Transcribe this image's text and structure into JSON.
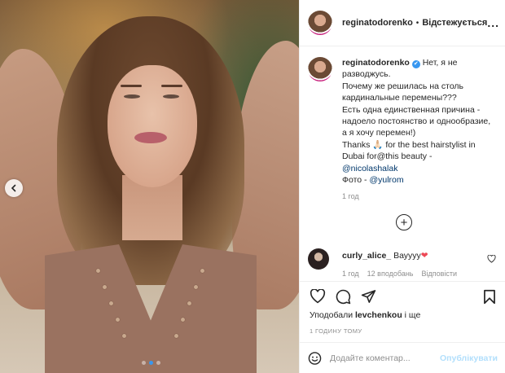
{
  "post": {
    "username": "reginatodorenko",
    "separator": "•",
    "follow_label": "Відстежується",
    "more_label": "..."
  },
  "caption": {
    "username": "reginatodorenko",
    "verified_mark": "✔",
    "lines": [
      "Нет, я не разводжусь.",
      "Почему же решилась на столь кардинальные перемены???",
      "Есть одна единственная причина - надоело постоянство и однообразие, а я хочу перемен!)",
      "Thanks 🙏🏻 for the best hairstylist in Dubai for@this beauty -",
      "@nicolashalak",
      "Фото - ",
      "@yulrom"
    ],
    "time_ago": "1 год"
  },
  "load_more_label": "+",
  "comment": {
    "username": "curly_alice_",
    "text": "Вауууу",
    "heart": "❤",
    "time": "1 год",
    "likes": "12 вподобань",
    "reply_label": "Відповісти"
  },
  "likes": {
    "prefix": "Уподобали ",
    "user": "levchenkou",
    "suffix": " і ще"
  },
  "posted_time": "1 ГОДИНУ ТОМУ",
  "comment_input": {
    "placeholder": "Додайте коментар...",
    "publish_label": "Опублікувати"
  },
  "carousel": {
    "current_index": 1,
    "total": 3
  },
  "colors": {
    "accent": "#3897f0",
    "link": "#00376b",
    "heart": "#ed4956",
    "publish_disabled": "#b2dffc"
  }
}
